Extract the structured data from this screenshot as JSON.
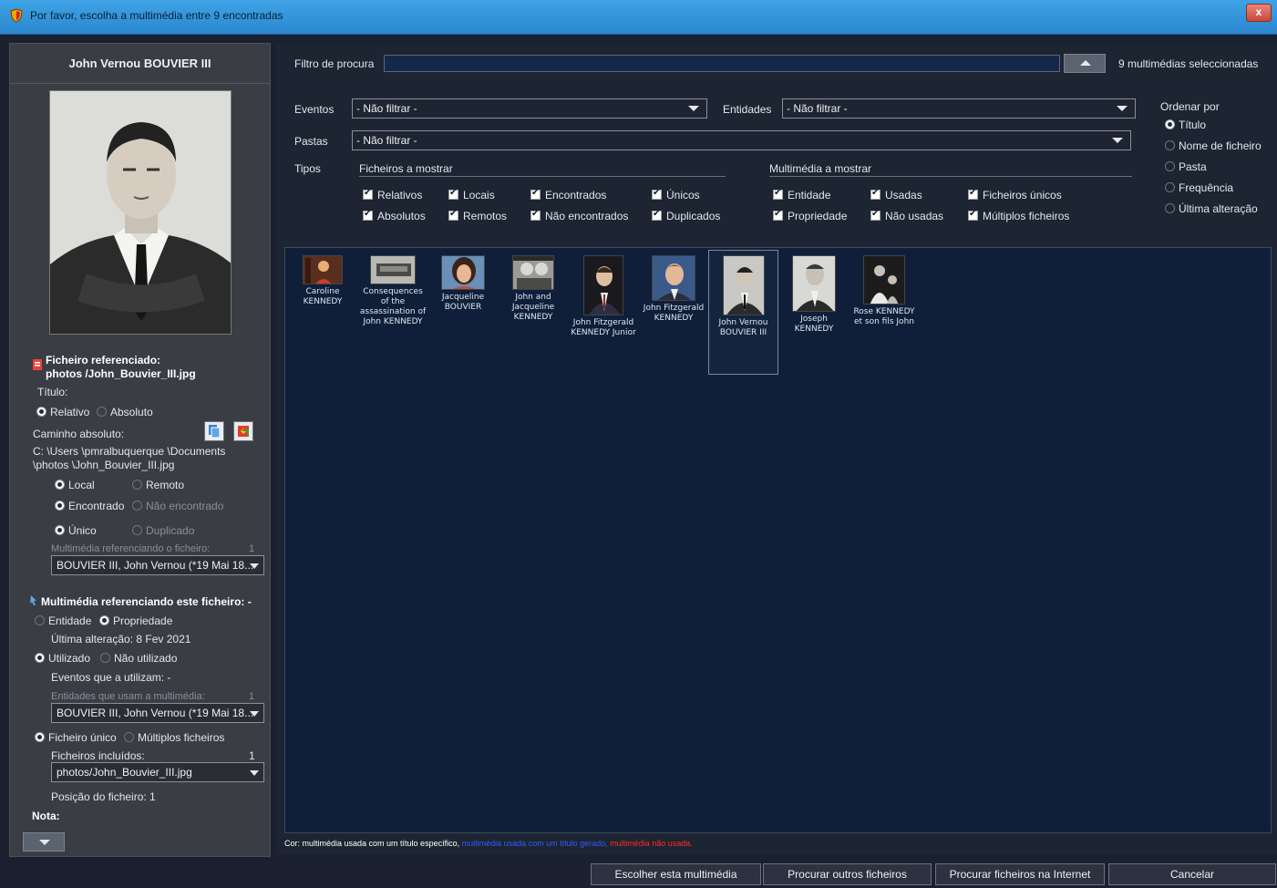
{
  "window": {
    "title": "Por favor, escolha a multimédia entre 9 encontradas",
    "close_label": "x"
  },
  "left_panel": {
    "person_name": "John Vernou BOUVIER III",
    "file_ref_label": "Ficheiro referenciado:",
    "file_ref_value": "photos /John_Bouvier_III.jpg",
    "title_label": "Título:",
    "path_mode": {
      "relativo": "Relativo",
      "absoluto": "Absoluto"
    },
    "absolute_path_label": "Caminho absoluto:",
    "absolute_path_line1": "C: \\Users \\pmralbuquerque \\Documents",
    "absolute_path_line2": "\\photos \\John_Bouvier_III.jpg",
    "local_label": "Local",
    "remote_label": "Remoto",
    "found_label": "Encontrado",
    "not_found_label": "Não encontrado",
    "unique_label": "Único",
    "duplicated_label": "Duplicado",
    "referencing_media_label": "Multimédia referenciando o ficheiro:",
    "referencing_media_count": "1",
    "referencing_media_combo": "BOUVIER III, John Vernou (*19 Mai 18...",
    "media_ref_header": "Multimédia referenciando este ficheiro: -",
    "entity_label": "Entidade",
    "property_label": "Propriedade",
    "last_change": "Última alteração: 8 Fev 2021",
    "used_label": "Utilizado",
    "not_used_label": "Não utilizado",
    "events_using": "Eventos que a utilizam: -",
    "entities_using_label": "Entidades que usam a multimédia:",
    "entities_using_count": "1",
    "entities_using_combo": "BOUVIER III, John Vernou (*19 Mai 18...",
    "single_file_label": "Ficheiro único",
    "multiple_files_label": "Múltiplos ficheiros",
    "included_files_label": "Ficheiros incluídos:",
    "included_files_count": "1",
    "included_files_combo": "photos/John_Bouvier_III.jpg",
    "file_position": "Posição do ficheiro: 1",
    "note_label": "Nota:"
  },
  "filters": {
    "search_label": "Filtro de procura",
    "search_value": "",
    "selected_count": "9 multimédias seleccionadas",
    "events_label": "Eventos",
    "events_value": "- Não filtrar -",
    "entities_label": "Entidades",
    "entities_value": "- Não filtrar -",
    "folders_label": "Pastas",
    "folders_value": "- Não filtrar -",
    "types_label": "Tipos",
    "files_section": "Ficheiros a mostrar",
    "media_section": "Multimédia a mostrar",
    "file_checks": [
      "Relativos",
      "Locais",
      "Encontrados",
      "Únicos",
      "Absolutos",
      "Remotos",
      "Não encontrados",
      "Duplicados"
    ],
    "media_checks": [
      "Entidade",
      "Usadas",
      "Ficheiros únicos",
      "Propriedade",
      "Não usadas",
      "Múltiplos ficheiros"
    ]
  },
  "sort": {
    "label": "Ordenar por",
    "options": [
      "Título",
      "Nome de ficheiro",
      "Pasta",
      "Frequência",
      "Última alteração"
    ],
    "selected": "Título"
  },
  "gallery": {
    "items": [
      {
        "caption": "Caroline KENNEDY"
      },
      {
        "caption": "Consequences of the assassination of John KENNEDY"
      },
      {
        "caption": "Jacqueline BOUVIER"
      },
      {
        "caption": "John and Jacqueline KENNEDY"
      },
      {
        "caption": "John Fitzgerald KENNEDY Junior"
      },
      {
        "caption": "John Fitzgerald KENNEDY"
      },
      {
        "caption": "John Vernou BOUVIER III"
      },
      {
        "caption": "Joseph KENNEDY"
      },
      {
        "caption": "Rose KENNEDY et son fils John"
      }
    ],
    "selected_index": 6
  },
  "legend": {
    "specific": "Cor: multimédia usada com um título específico,",
    "generated": " multimédia usada com um título gerado,",
    "unused": " multimédia não usada."
  },
  "colors": {
    "legend_specific": "#ffffff",
    "legend_generated": "#2f5bff",
    "legend_unused": "#ff2a2a"
  },
  "buttons": {
    "choose": "Escolher esta multimédia",
    "search_other": "Procurar outros ficheiros",
    "search_internet": "Procurar ficheiros na Internet",
    "cancel": "Cancelar"
  }
}
